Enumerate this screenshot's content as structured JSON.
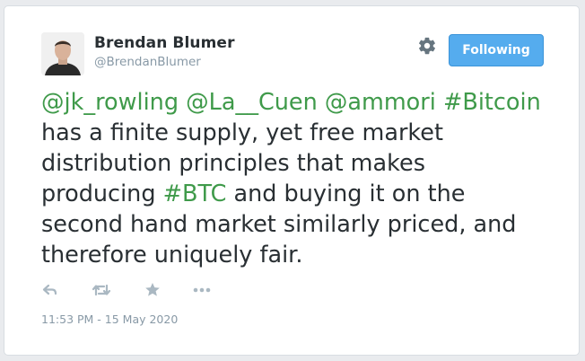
{
  "tweet": {
    "author_name": "Brendan Blumer",
    "author_handle": "@BrendanBlumer",
    "text_parts": [
      {
        "text": "@jk_rowling",
        "link": true
      },
      {
        "text": " ",
        "link": false
      },
      {
        "text": "@La__Cuen",
        "link": true
      },
      {
        "text": " ",
        "link": false
      },
      {
        "text": "@ammori",
        "link": true
      },
      {
        "text": " ",
        "link": false
      },
      {
        "text": "#Bitcoin",
        "link": true
      },
      {
        "text": " has a finite supply, yet free market distribution principles that makes producing ",
        "link": false
      },
      {
        "text": "#BTC",
        "link": true
      },
      {
        "text": " and buying it on the second hand market similarly priced, and therefore uniquely fair.",
        "link": false
      }
    ],
    "timestamp": "11:53 PM - 15 May 2020"
  },
  "header": {
    "follow_button_label": "Following",
    "settings_icon": "gear-icon"
  },
  "actions": [
    {
      "name": "reply-icon"
    },
    {
      "name": "retweet-icon"
    },
    {
      "name": "like-icon"
    },
    {
      "name": "more-icon"
    }
  ],
  "colors": {
    "link": "#3f9a4a",
    "button": "#55acee",
    "text": "#292f33",
    "muted": "#8899a6"
  }
}
